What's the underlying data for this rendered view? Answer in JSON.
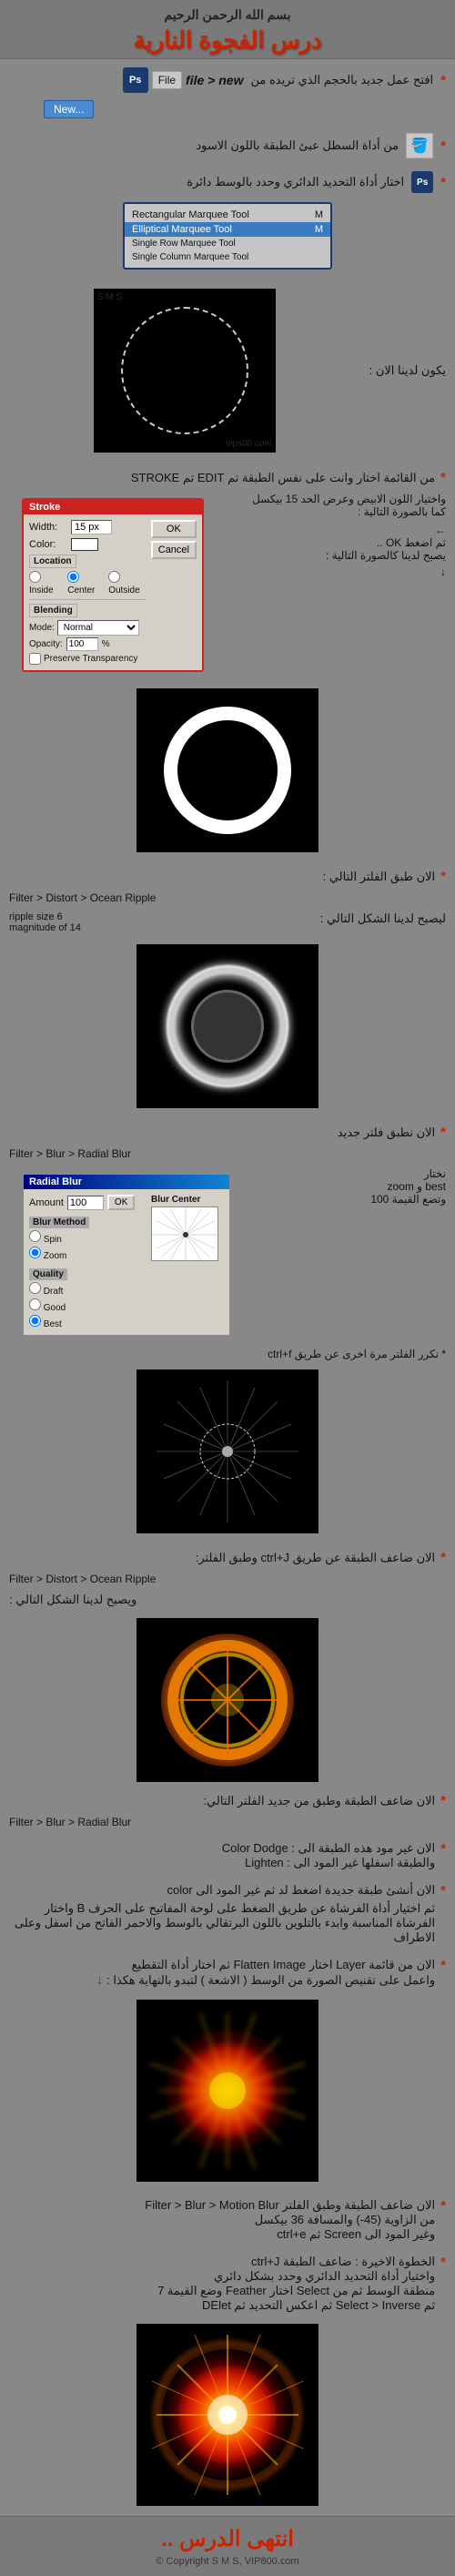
{
  "header": {
    "bismillah": "بسم الله الرحمن الرحيم",
    "title": "درس الفجوة النارية"
  },
  "watermarks": [
    "vips00.com",
    "S M S"
  ],
  "steps": {
    "step1": {
      "marker": "*",
      "text_ar": "افتح عمل جديد بالحجم الذي تريده من",
      "file_label": "file > new",
      "menu_text": "File",
      "new_button": "New..."
    },
    "step2": {
      "marker": "*",
      "text_ar": "من أداة السطل عبئ الطبقة باللون الاسود"
    },
    "step3": {
      "marker": "*",
      "text_ar": "اختار أداة التحديد الدائري وحدد بالوسط دائرة"
    },
    "tools_dialog": {
      "items": [
        {
          "name": "Rectangular Marquee Tool",
          "shortcut": "M",
          "selected": false
        },
        {
          "name": "Elliptical Marquee Tool",
          "shortcut": "M",
          "selected": true
        },
        {
          "name": "Single Row Marquee Tool",
          "shortcut": "",
          "selected": false
        },
        {
          "name": "Single Column Marquee Tool",
          "shortcut": "",
          "selected": false
        }
      ]
    },
    "canvas_label": "يكون لدينا الان :",
    "step4": {
      "marker": "*",
      "text_ar": "من القائمة اختار وانت على نفس الطبقة تم  EDIT  تم  STROKE"
    },
    "stroke_dialog": {
      "title": "Stroke",
      "width_label": "Width:",
      "width_value": "15 px",
      "color_label": "Color:",
      "ok_label": "OK",
      "cancel_label": "Cancel",
      "location_title": "Location",
      "location_options": [
        "Inside",
        "Center",
        "Outside"
      ],
      "blending_title": "Blending",
      "mode_label": "Mode:",
      "mode_value": "Normal",
      "opacity_label": "Opacity:",
      "opacity_value": "100",
      "opacity_unit": "%",
      "preserve_label": "Preserve Transparency"
    },
    "stroke_instructions": {
      "line1": "واختيار اللون الابيض وعرض الحد 15 بيكسل",
      "line2": "كما بالصورة التالية :",
      "line3": "ثم اضغط OK ..",
      "line4": "يصبح لدينا كالصورة التالية :"
    },
    "step5": {
      "marker": "*",
      "text": "الان طبق الفلتر التالي :",
      "filter": "Filter > Distort > Ocean Ripple",
      "values": "ripple size 6\nmagnitude of 14",
      "result_label": "ليصبح لدينا الشكل التالي :"
    },
    "step6": {
      "marker": "*",
      "text": "الان نطبق فلتر جديد",
      "filter": "Filter > Blur > Radial Blur",
      "select_label": "نختار",
      "zoom_best_label": "best و zoom",
      "amount_label": "وتضع القيمة 100",
      "ctrl_label": "* نكرر الفلتر مرة اخرى عن طريق ctrl+f"
    },
    "radial_blur_dialog": {
      "title": "Radial Blur",
      "amount_label": "Amount",
      "amount_value": "100",
      "ok_label": "OK",
      "blur_method_title": "Blur Method",
      "spin_label": "Spin",
      "zoom_label": "Zoom",
      "quality_title": "Quality",
      "draft_label": "Draft",
      "good_label": "Good",
      "best_label": "Best",
      "blur_center_label": "Blur Center"
    },
    "step7": {
      "marker": "*",
      "text1": "الان ضاعف الطبقة عن طريق ctrl+J  وطبق الفلتر:",
      "filter1": "Filter > Distort > Ocean Ripple",
      "result_label": "ويصبح لدينا الشكل التالي :",
      "text2": "الان ضاعف الطبقة وطبق من جديد الفلتر التالي:",
      "filter2": "Filter > Blur > Radial Blur"
    },
    "step8": {
      "marker": "*",
      "text1": "الان غير مود هذه الطبقة الى : Color Dodge",
      "text2": "والطبقة اسفلها غير المود الى : Lighten"
    },
    "step9": {
      "marker": "*",
      "text1": "الان أنشئ طبقة جديدة اضغط  لد  ثم غير المود الى color",
      "text2": "ثم اختيار أداة الفرشاة عن طريق الضغط على لوحة المفاتيح على الحرف B واختار الفرشاة المناسبة وابدء بالتلوين باللون البرتقالي بالوسط والاحمر الفاتح من اسفل وعلى الاطراف"
    },
    "step10": {
      "marker": "*",
      "text1": "الان من قائمة Layer اختار Flatten Image ثم اختار أداة التقطيع",
      "text2": "واعمل على تقنيص الصورة من الوسط ( الاشعة ) لتبدو بالنهاية هكذا :",
      "arrow": "↓"
    },
    "step11": {
      "marker": "*",
      "text1": "الان ضاعف الطبقة وطبق الفلتر Filter > Blur > Motion Blur",
      "text2": "من الزاوية (45-) والمسافة 36 بيكسل",
      "text3": "وغير المود الى Screen ثم ctrl+e"
    },
    "step12": {
      "marker": "*",
      "text1": "الخطوة الاخيرة : ضاعف الطبقة ctrl+J",
      "text2": "واختيار أداة التحديد الدائري وحدد بشكل دائري",
      "text3": "منطقة الوسط ثم من Select اختار Feather وضع القيمة 7",
      "text4": "ثم Select > Inverse  ثم اعكس التحديد ثم DElet"
    }
  },
  "footer": {
    "title": "انتهى الدرس ..",
    "copyright": "© Copyright S M S,  VIP800.com"
  },
  "colors": {
    "bg": "#888888",
    "header_bg": "#7a7a7a",
    "accent_red": "#cc2200",
    "ps_blue": "#1a3a6e",
    "dialog_bg": "#d4d0c8",
    "dialog_red": "#cc2222"
  }
}
